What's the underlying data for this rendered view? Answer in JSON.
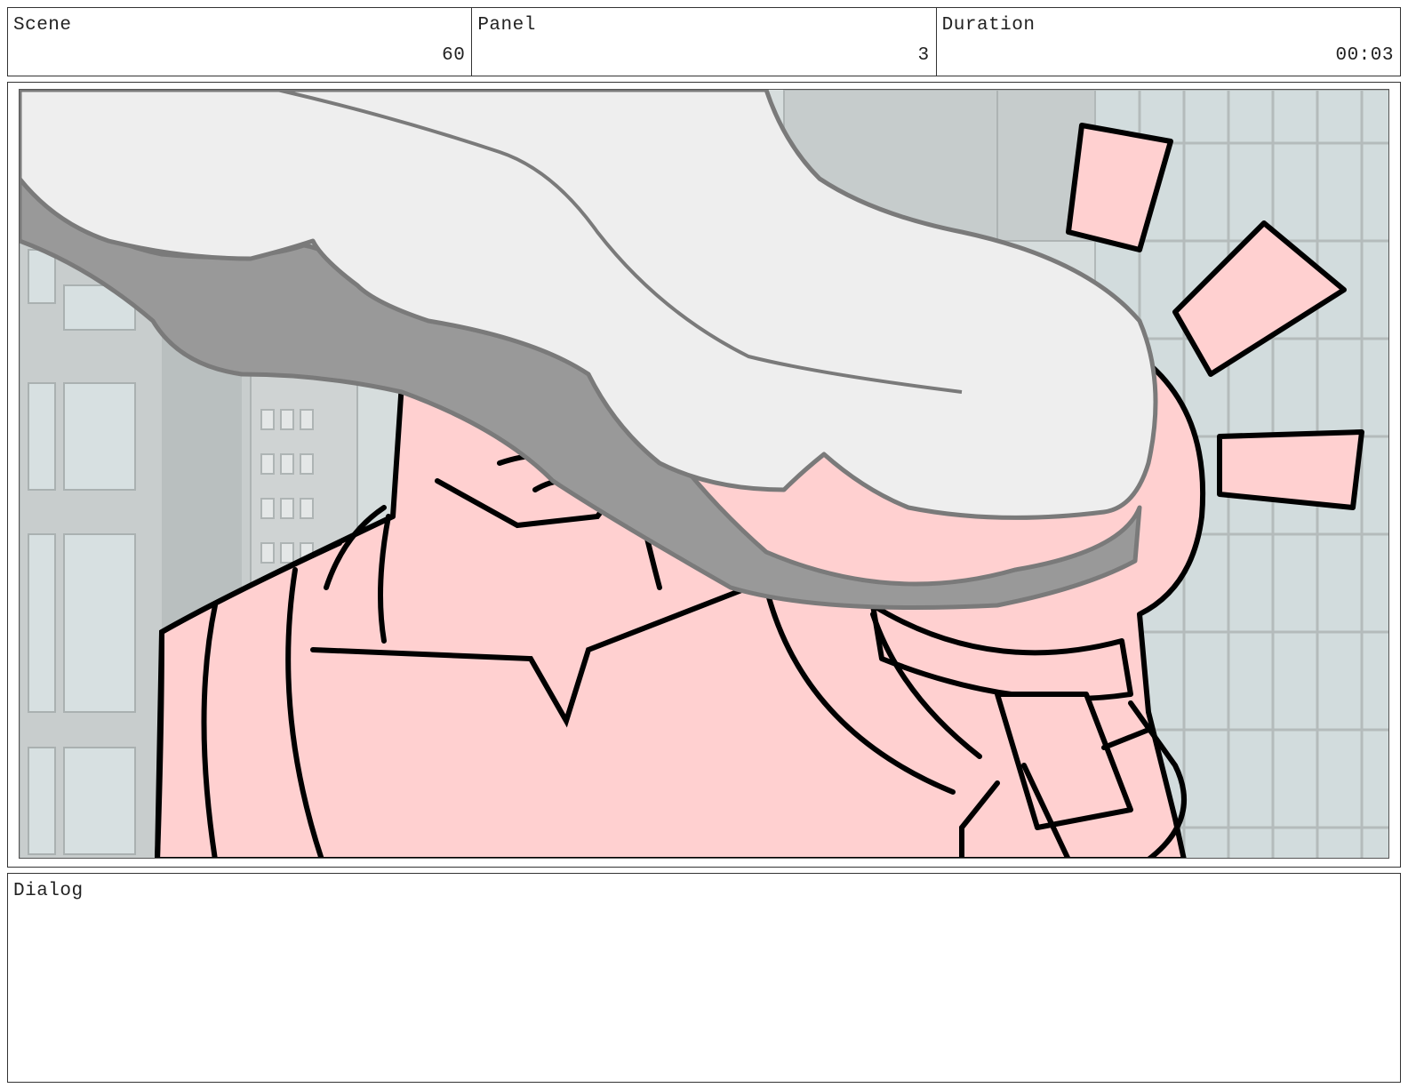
{
  "header": {
    "scene_label": "Scene",
    "scene_value": "60",
    "panel_label": "Panel",
    "panel_value": "3",
    "duration_label": "Duration",
    "duration_value": "00:03"
  },
  "dialog": {
    "label": "Dialog",
    "text": ""
  },
  "colors": {
    "skin": "#ffd0d0",
    "smoke_light": "#eeeeee",
    "smoke_dark": "#999999",
    "building": "#c9cfcf",
    "glass": "#d4dfe0",
    "ink": "#000000"
  }
}
